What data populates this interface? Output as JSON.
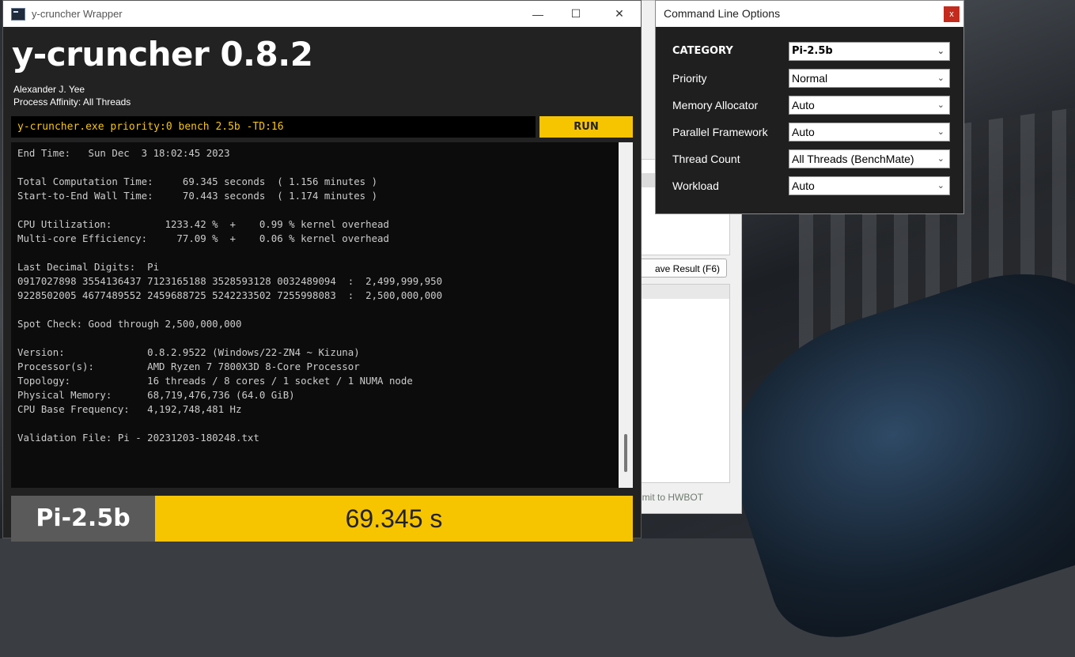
{
  "main": {
    "window_title": "y-cruncher Wrapper",
    "controls": {
      "minimize": "—",
      "maximize": "☐",
      "close": "✕"
    },
    "app_title": "y-cruncher 0.8.2",
    "author": "Alexander J. Yee",
    "affinity": "Process Affinity: All Threads",
    "command": "y-cruncher.exe priority:0 bench 2.5b -TD:16",
    "run_label": "RUN",
    "console_lines": [
      "End Time:   Sun Dec  3 18:02:45 2023",
      "",
      "Total Computation Time:     69.345 seconds  ( 1.156 minutes )",
      "Start-to-End Wall Time:     70.443 seconds  ( 1.174 minutes )",
      "",
      "CPU Utilization:         1233.42 %  +    0.99 % kernel overhead",
      "Multi-core Efficiency:     77.09 %  +    0.06 % kernel overhead",
      "",
      "Last Decimal Digits:  Pi",
      "0917027898 3554136437 7123165188 3528593128 0032489094  :  2,499,999,950",
      "9228502005 4677489552 2459688725 5242233502 7255998083  :  2,500,000,000",
      "",
      "Spot Check: Good through 2,500,000,000",
      "",
      "Version:              0.8.2.9522 (Windows/22-ZN4 ~ Kizuna)",
      "Processor(s):         AMD Ryzen 7 7800X3D 8-Core Processor",
      "Topology:             16 threads / 8 cores / 1 socket / 1 NUMA node",
      "Physical Memory:      68,719,476,736 (64.0 GiB)",
      "CPU Base Frequency:   4,192,748,481 Hz",
      "",
      "Validation File: Pi - 20231203-180248.txt"
    ],
    "result_category": "Pi-2.5b",
    "result_time": "69.345 s"
  },
  "middle": {
    "save_result_label": "ave Result (F6)",
    "submit_label": "mit to HWBOT"
  },
  "options": {
    "title": "Command Line Options",
    "close": "x",
    "rows": [
      {
        "label": "CATEGORY",
        "value": "Pi-2.5b"
      },
      {
        "label": "Priority",
        "value": "Normal"
      },
      {
        "label": "Memory Allocator",
        "value": "Auto"
      },
      {
        "label": "Parallel Framework",
        "value": "Auto"
      },
      {
        "label": "Thread Count",
        "value": "All Threads (BenchMate)"
      },
      {
        "label": "Workload",
        "value": "Auto"
      }
    ],
    "chevron": "⌄"
  },
  "colors": {
    "accent": "#f7c400",
    "console_bg": "#0c0c0c",
    "close_red": "#c42b1c"
  }
}
